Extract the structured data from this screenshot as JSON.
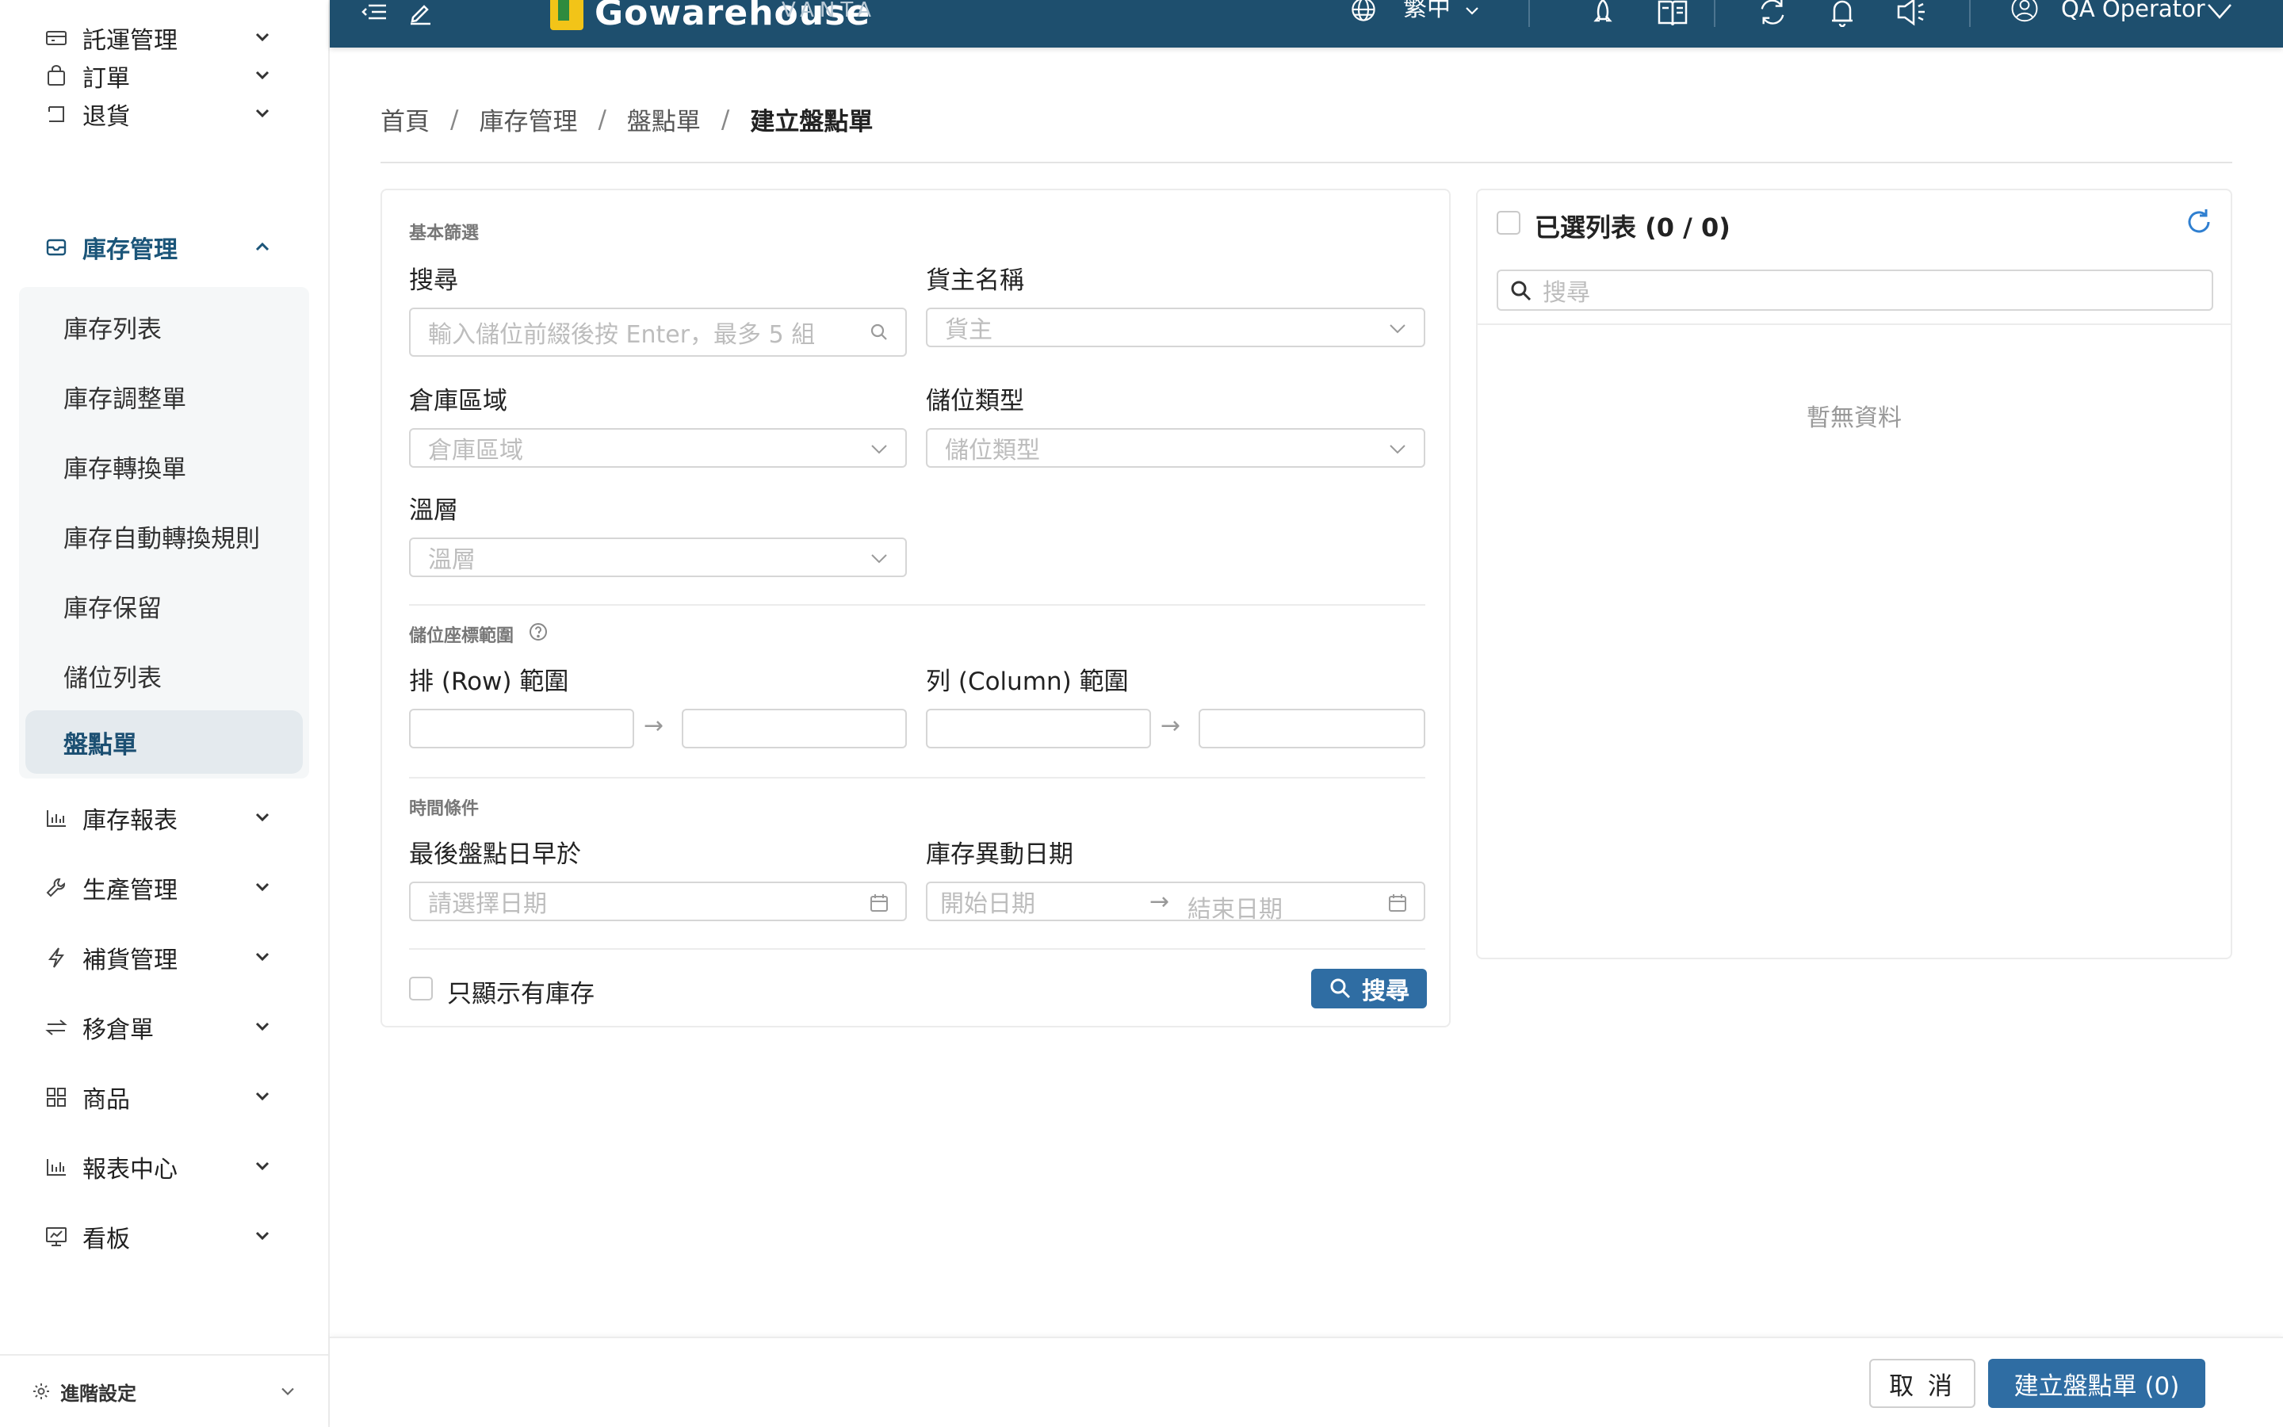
{
  "header": {
    "logo_text": "Gowarehouse",
    "logo_sub": "VANTA",
    "language": "繁中",
    "user_name": "QA Operator"
  },
  "sidebar": {
    "top_items": [
      {
        "label": "託運管理",
        "icon": "truck-icon"
      },
      {
        "label": "訂單",
        "icon": "bag-icon"
      },
      {
        "label": "退貨",
        "icon": "return-icon"
      },
      {
        "label": "庫存管理",
        "icon": "inbox-icon"
      }
    ],
    "sub_items": [
      {
        "label": "庫存列表"
      },
      {
        "label": "庫存調整單"
      },
      {
        "label": "庫存轉換單"
      },
      {
        "label": "庫存自動轉換規則"
      },
      {
        "label": "庫存保留"
      },
      {
        "label": "儲位列表"
      },
      {
        "label": "盤點單"
      }
    ],
    "bottom_items": [
      {
        "label": "庫存報表",
        "icon": "bar-chart-icon"
      },
      {
        "label": "生產管理",
        "icon": "wrench-icon"
      },
      {
        "label": "補貨管理",
        "icon": "lightning-icon"
      },
      {
        "label": "移倉單",
        "icon": "swap-icon"
      },
      {
        "label": "商品",
        "icon": "grid-icon"
      },
      {
        "label": "報表中心",
        "icon": "report-icon"
      },
      {
        "label": "看板",
        "icon": "dashboard-icon"
      }
    ],
    "advanced_settings": "進階設定"
  },
  "breadcrumb": {
    "home": "首頁",
    "inventory": "庫存管理",
    "stocktake": "盤點單",
    "current": "建立盤點單"
  },
  "filters": {
    "basic_section": "基本篩選",
    "search_label": "搜尋",
    "search_placeholder": "輸入儲位前綴後按 Enter，最多 5 組",
    "owner_label": "貨主名稱",
    "owner_placeholder": "貨主",
    "zone_label": "倉庫區域",
    "zone_placeholder": "倉庫區域",
    "location_type_label": "儲位類型",
    "location_type_placeholder": "儲位類型",
    "temperature_label": "溫層",
    "temperature_placeholder": "溫層",
    "coord_section": "儲位座標範圍",
    "row_range_label": "排 (Row) 範圍",
    "column_range_label": "列 (Column) 範圍",
    "time_section": "時間條件",
    "last_count_label": "最後盤點日早於",
    "last_count_placeholder": "請選擇日期",
    "movement_label": "庫存異動日期",
    "start_date_placeholder": "開始日期",
    "end_date_placeholder": "結束日期",
    "only_stock_label": "只顯示有庫存",
    "search_button": "搜尋"
  },
  "selected_list": {
    "title": "已選列表 (0 / 0)",
    "search_placeholder": "搜尋",
    "empty_text": "暫無資料"
  },
  "footer": {
    "cancel_label": "取 消",
    "create_label": "建立盤點單 (0)"
  },
  "colors": {
    "header_bg": "#1e4f6e",
    "primary": "#2f6da3",
    "active_menu": "#1b5579",
    "refresh_blue": "#2f7fd0"
  }
}
